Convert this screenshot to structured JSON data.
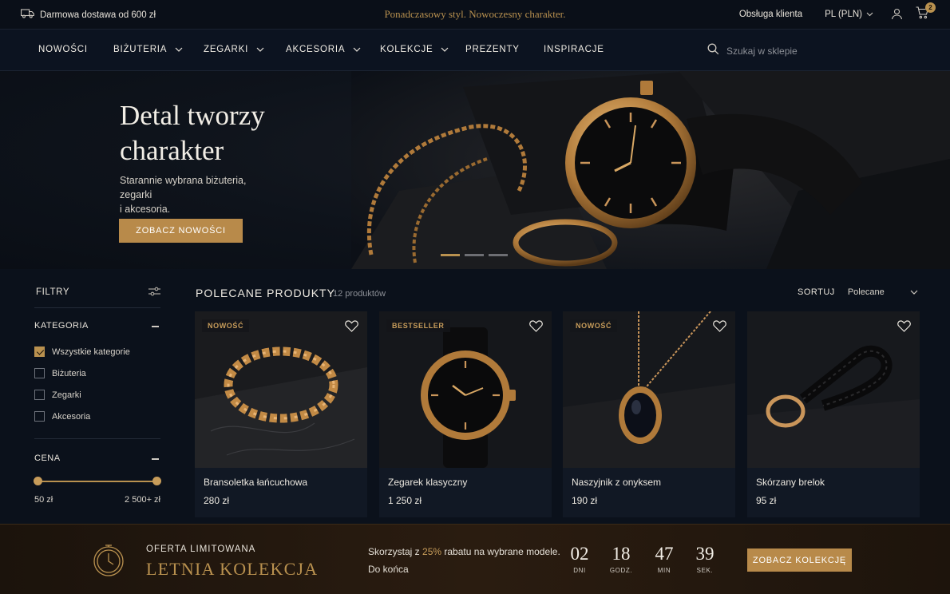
{
  "topbar": {
    "shipping": "Darmowa dostawa od 600 zł",
    "tagline": "Ponadczasowy styl. Nowoczesny charakter.",
    "service": "Obsługa klienta",
    "language": "PL (PLN)",
    "cart_count": "2"
  },
  "nav": {
    "items": [
      {
        "label": "NOWOŚCI"
      },
      {
        "label": "BIŻUTERIA"
      },
      {
        "label": "ZEGARKI"
      },
      {
        "label": "AKCESORIA"
      },
      {
        "label": "KOLEKCJE"
      },
      {
        "label": "PREZENTY"
      },
      {
        "label": "INSPIRACJE"
      }
    ],
    "search_placeholder": "Szukaj w sklepie"
  },
  "hero": {
    "title_line1": "Detal tworzy",
    "title_line2": "charakter",
    "subtitle_line1": "Starannie wybrana biżuteria, zegarki",
    "subtitle_line2": "i akcesoria.",
    "cta": "ZOBACZ NOWOŚCI",
    "active_slide": 1,
    "slide_count": 3
  },
  "filters": {
    "title": "FILTRY",
    "category_title": "KATEGORIA",
    "categories": [
      {
        "label": "Wszystkie kategorie",
        "checked": true
      },
      {
        "label": "Biżuteria",
        "checked": false
      },
      {
        "label": "Zegarki",
        "checked": false
      },
      {
        "label": "Akcesoria",
        "checked": false
      }
    ],
    "price_title": "CENA",
    "price_min": "50 zł",
    "price_max": "2 500+ zł"
  },
  "products": {
    "heading": "POLECANE PRODUKTY",
    "count": "12 produktów",
    "sort_label": "SORTUJ",
    "sort_value": "Polecane",
    "items": [
      {
        "badge": "NOWOŚĆ",
        "name": "Bransoletka łańcuchowa",
        "price": "280 zł"
      },
      {
        "badge": "BESTSELLER",
        "name": "Zegarek klasyczny",
        "price": "1 250 zł"
      },
      {
        "badge": "NOWOŚĆ",
        "name": "Naszyjnik z onyksem",
        "price": "190 zł"
      },
      {
        "badge": "",
        "name": "Skórzany brelok",
        "price": "95 zł"
      }
    ]
  },
  "promo": {
    "kicker": "OFERTA LIMITOWANA",
    "title": "LETNIA KOLEKCJA",
    "desc_prefix": "Skorzystaj z ",
    "desc_highlight": "25%",
    "desc_suffix": " rabatu na wybrane modele.",
    "until": "Do końca",
    "countdown": [
      {
        "value": "02",
        "label": "DNI"
      },
      {
        "value": "18",
        "label": "GODZ."
      },
      {
        "value": "47",
        "label": "MIN"
      },
      {
        "value": "39",
        "label": "SEK."
      }
    ],
    "cta": "ZOBACZ KOLEKCJĘ"
  },
  "colors": {
    "accent": "#b9914f",
    "background": "#0b111b",
    "button": "#b88a4a"
  }
}
